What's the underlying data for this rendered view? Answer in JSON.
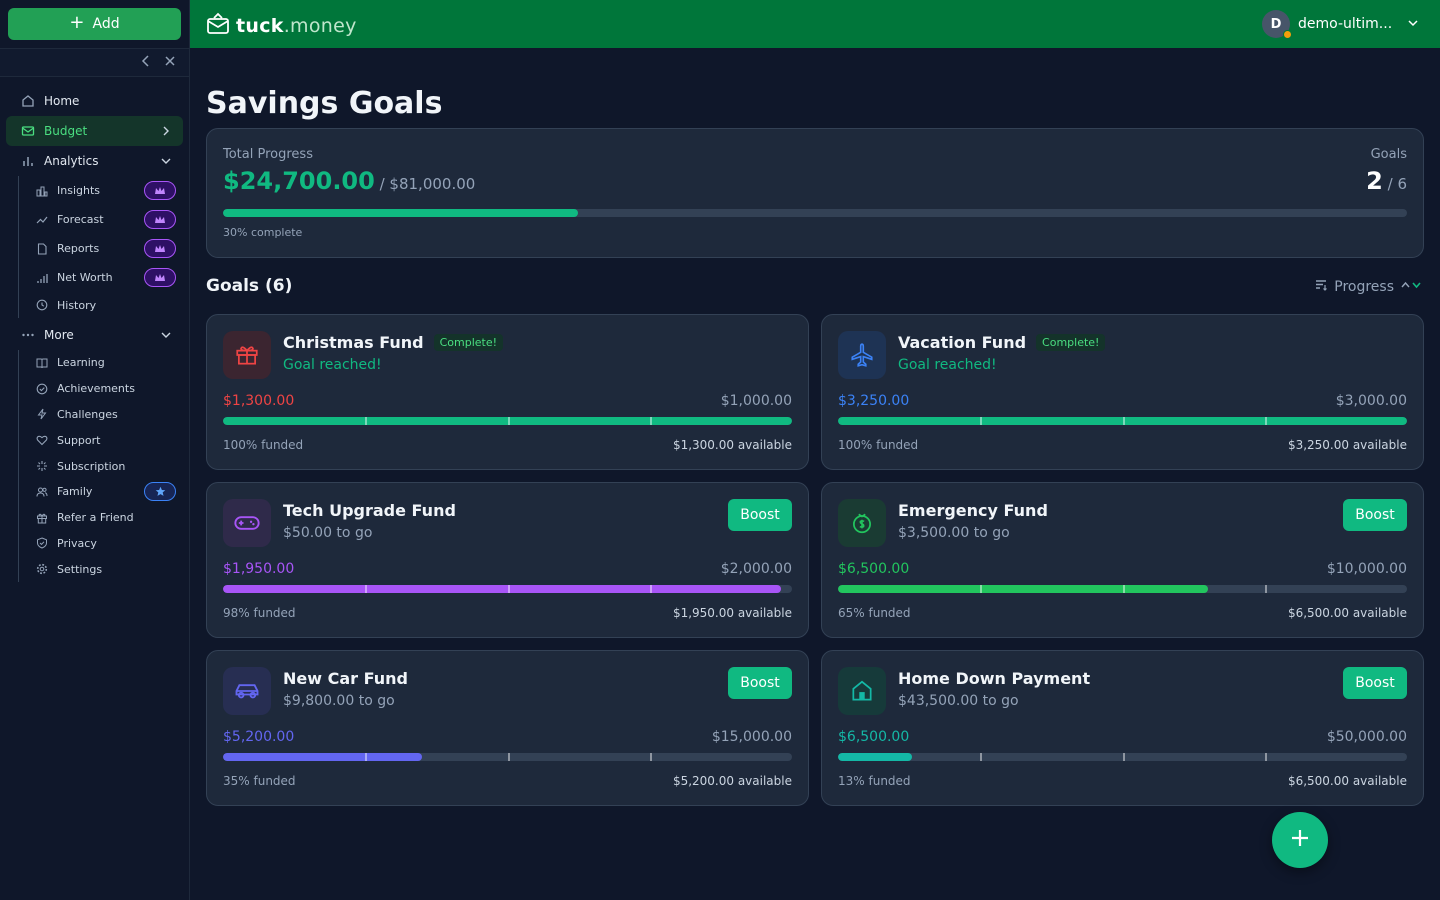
{
  "sidebar": {
    "add_label": "Add",
    "collapse_icon": "chevron-left-icon",
    "close_icon": "close-icon",
    "items": [
      {
        "label": "Home",
        "icon": "home-icon"
      },
      {
        "label": "Budget",
        "icon": "envelope-icon"
      },
      {
        "label": "Analytics",
        "icon": "bar-chart-icon"
      }
    ],
    "analytics_sub": [
      {
        "label": "Insights",
        "icon": "chart-icon",
        "badge": "crown-icon"
      },
      {
        "label": "Forecast",
        "icon": "trend-icon",
        "badge": "crown-icon"
      },
      {
        "label": "Reports",
        "icon": "file-icon",
        "badge": "crown-icon"
      },
      {
        "label": "Net Worth",
        "icon": "signal-icon",
        "badge": "crown-icon"
      },
      {
        "label": "History",
        "icon": "clock-icon"
      }
    ],
    "more_label": "More",
    "more_sub": [
      {
        "label": "Learning",
        "icon": "book-icon"
      },
      {
        "label": "Achievements",
        "icon": "check-circle-icon"
      },
      {
        "label": "Challenges",
        "icon": "bolt-icon"
      },
      {
        "label": "Support",
        "icon": "heart-icon"
      },
      {
        "label": "Subscription",
        "icon": "sparkle-icon"
      },
      {
        "label": "Family",
        "icon": "users-icon",
        "badge": "star-icon"
      },
      {
        "label": "Refer a Friend",
        "icon": "gift-icon"
      },
      {
        "label": "Privacy",
        "icon": "shield-icon"
      },
      {
        "label": "Settings",
        "icon": "gear-icon"
      }
    ]
  },
  "header": {
    "logo_bold": "tuck",
    "logo_light": ".money",
    "avatar_initial": "D",
    "username": "demo-ultim..."
  },
  "main": {
    "title": "Savings Goals",
    "total": {
      "label": "Total Progress",
      "amount": "$24,700.00",
      "of_amount": " / $81,000.00",
      "goals_label": "Goals",
      "goals_done": "2",
      "goals_total": " / 6",
      "percent_value": 30,
      "percent_text": "30% complete"
    },
    "goals_heading": "Goals (6)",
    "sort_label": "Progress",
    "boost_label": "Boost",
    "complete_label": "Complete!",
    "goals": [
      {
        "name": "Christmas Fund",
        "icon": "gift-icon",
        "complete": true,
        "sub": "Goal reached!",
        "current": "$1,300.00",
        "target": "$1,000.00",
        "pct": 100,
        "funded": "100% funded",
        "available": "$1,300.00 available",
        "color": "#ef4444",
        "icon_bg": "#3b2530",
        "bar": "#10b981"
      },
      {
        "name": "Vacation Fund",
        "icon": "airplane-icon",
        "complete": true,
        "sub": "Goal reached!",
        "current": "$3,250.00",
        "target": "$3,000.00",
        "pct": 100,
        "funded": "100% funded",
        "available": "$3,250.00 available",
        "color": "#3b82f6",
        "icon_bg": "#1e3354",
        "bar": "#10b981"
      },
      {
        "name": "Tech Upgrade Fund",
        "icon": "gamepad-icon",
        "complete": false,
        "sub": "$50.00 to go",
        "current": "$1,950.00",
        "target": "$2,000.00",
        "pct": 98,
        "funded": "98% funded",
        "available": "$1,950.00 available",
        "color": "#a855f7",
        "icon_bg": "#2f2a4a",
        "bar": "#a855f7"
      },
      {
        "name": "Emergency Fund",
        "icon": "piggy-bank-icon",
        "complete": false,
        "sub": "$3,500.00 to go",
        "current": "$6,500.00",
        "target": "$10,000.00",
        "pct": 65,
        "funded": "65% funded",
        "available": "$6,500.00 available",
        "color": "#22c55e",
        "icon_bg": "#1a3b33",
        "bar": "#22c55e"
      },
      {
        "name": "New Car Fund",
        "icon": "car-icon",
        "complete": false,
        "sub": "$9,800.00 to go",
        "current": "$5,200.00",
        "target": "$15,000.00",
        "pct": 35,
        "funded": "35% funded",
        "available": "$5,200.00 available",
        "color": "#6366f1",
        "icon_bg": "#272e52",
        "bar": "#6366f1"
      },
      {
        "name": "Home Down Payment",
        "icon": "house-icon",
        "complete": false,
        "sub": "$43,500.00 to go",
        "current": "$6,500.00",
        "target": "$50,000.00",
        "pct": 13,
        "funded": "13% funded",
        "available": "$6,500.00 available",
        "color": "#14b8a6",
        "icon_bg": "#163a3a",
        "bar": "#14b8a6"
      }
    ]
  }
}
